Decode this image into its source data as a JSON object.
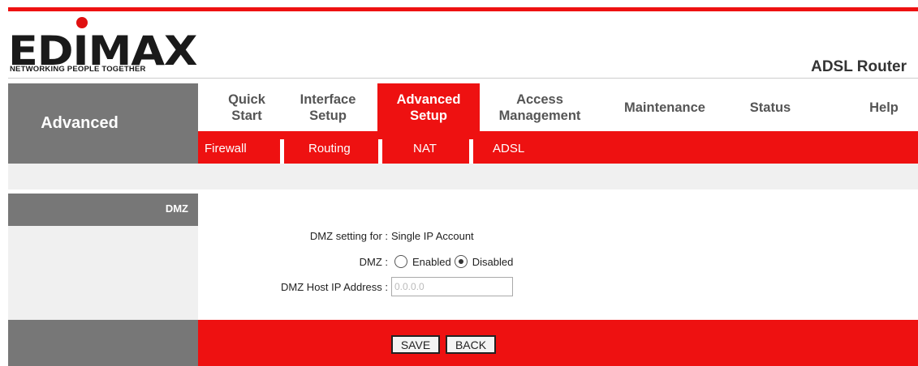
{
  "brand": {
    "logo_text": "EDIMAX",
    "tagline": "NETWORKING PEOPLE TOGETHER",
    "product": "ADSL Router",
    "accent": "#ee1111",
    "sidebar_gray": "#777777"
  },
  "nav": {
    "section_label": "Advanced",
    "tabs": [
      {
        "label": "Quick\nStart"
      },
      {
        "label": "Interface\nSetup"
      },
      {
        "label": "Advanced\nSetup",
        "active": true
      },
      {
        "label": "Access\nManagement"
      },
      {
        "label": "Maintenance"
      },
      {
        "label": "Status"
      },
      {
        "label": "Help"
      }
    ],
    "subtabs": [
      "Firewall",
      "Routing",
      "NAT",
      "ADSL"
    ]
  },
  "dmz": {
    "side_label": "DMZ",
    "setting_for_label": "DMZ setting for :",
    "setting_for_value": "Single IP Account",
    "dmz_label": "DMZ :",
    "options": [
      "Enabled",
      "Disabled"
    ],
    "selected": "Disabled",
    "host_ip_label": "DMZ Host IP Address :",
    "host_ip_value": "0.0.0.0"
  },
  "buttons": {
    "save": "SAVE",
    "back": "BACK"
  }
}
